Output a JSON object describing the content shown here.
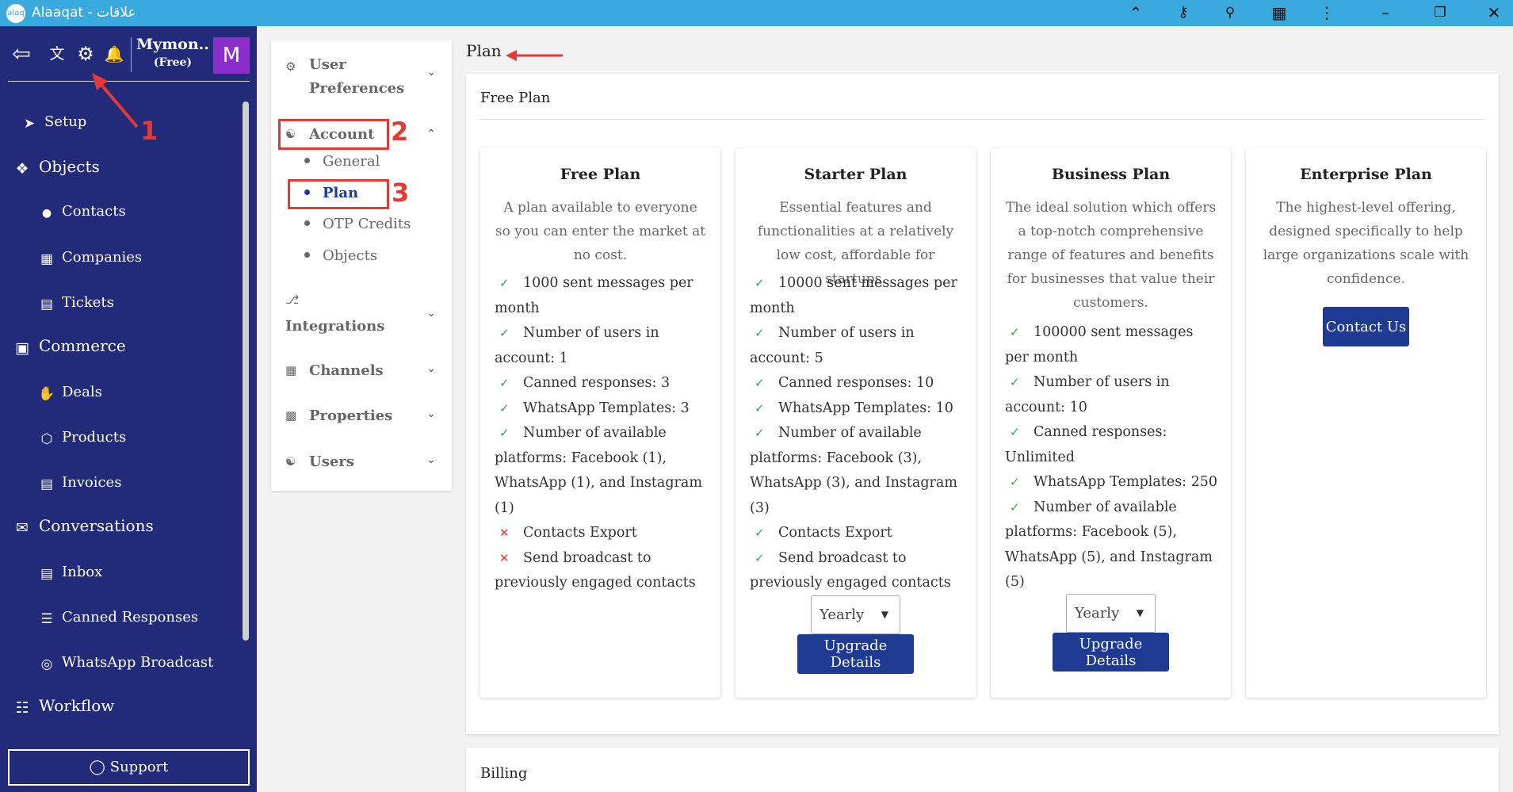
{
  "window": {
    "logo_text": "alaq",
    "title": "Alaaqat - علاقات",
    "icons": [
      "chevron-up-icon",
      "key-icon",
      "search-icon",
      "extension-icon",
      "more-vert-icon",
      "minimize-icon",
      "restore-icon",
      "close-icon"
    ]
  },
  "sidebar": {
    "user_name": "Mymon...",
    "user_plan": "(Free)",
    "avatar_letter": "M",
    "items": [
      {
        "label": "Setup",
        "icon": "rocket-icon",
        "type": "sub"
      },
      {
        "label": "Objects",
        "icon": "diamond-grid-icon",
        "type": "group"
      },
      {
        "label": "Contacts",
        "icon": "person-icon",
        "type": "sub"
      },
      {
        "label": "Companies",
        "icon": "building-icon",
        "type": "sub"
      },
      {
        "label": "Tickets",
        "icon": "ticket-icon",
        "type": "sub"
      },
      {
        "label": "Commerce",
        "icon": "bag-icon",
        "type": "group"
      },
      {
        "label": "Deals",
        "icon": "handshake-icon",
        "type": "sub"
      },
      {
        "label": "Products",
        "icon": "box-icon",
        "type": "sub"
      },
      {
        "label": "Invoices",
        "icon": "invoice-icon",
        "type": "sub"
      },
      {
        "label": "Conversations",
        "icon": "chat-icon",
        "type": "group"
      },
      {
        "label": "Inbox",
        "icon": "inbox-icon",
        "type": "sub"
      },
      {
        "label": "Canned Responses",
        "icon": "canned-icon",
        "type": "sub"
      },
      {
        "label": "WhatsApp Broadcast",
        "icon": "broadcast-icon",
        "type": "sub"
      },
      {
        "label": "Workflow",
        "icon": "sitemap-icon",
        "type": "group"
      }
    ],
    "support_label": "Support"
  },
  "settings_nav": {
    "user_preferences": "User Preferences",
    "account": "Account",
    "account_sub": [
      "General",
      "Plan",
      "OTP Credits",
      "Objects"
    ],
    "integrations": "Integrations",
    "channels": "Channels",
    "properties": "Properties",
    "users": "Users"
  },
  "annotations": {
    "n1": "1",
    "n2": "2",
    "n3": "3"
  },
  "main": {
    "page_title": "Plan",
    "section_title": "Free Plan",
    "billing_title": "Billing",
    "plans": [
      {
        "name": "Free Plan",
        "description": "A plan available to everyone so you can enter the market at no cost.",
        "features": [
          {
            "text": "1000 sent messages per month",
            "included": true
          },
          {
            "text": "Number of users in account: 1",
            "included": true
          },
          {
            "text": "Canned responses: 3",
            "included": true
          },
          {
            "text": "WhatsApp Templates: 3",
            "included": true
          },
          {
            "text": "Number of available platforms: Facebook (1), WhatsApp (1), and Instagram (1)",
            "included": true
          },
          {
            "text": "Contacts Export",
            "included": false
          },
          {
            "text": "Send broadcast to previously engaged contacts",
            "included": false
          }
        ]
      },
      {
        "name": "Starter Plan",
        "description": "Essential features and functionalities at a relatively low cost, affordable for startups.",
        "features": [
          {
            "text": "10000 sent messages per month",
            "included": true
          },
          {
            "text": "Number of users in account: 5",
            "included": true
          },
          {
            "text": "Canned responses: 10",
            "included": true
          },
          {
            "text": "WhatsApp Templates: 10",
            "included": true
          },
          {
            "text": "Number of available platforms: Facebook (3), WhatsApp (3), and Instagram (3)",
            "included": true
          },
          {
            "text": "Contacts Export",
            "included": true
          },
          {
            "text": "Send broadcast to previously engaged contacts",
            "included": true
          }
        ],
        "billing_period": "Yearly",
        "button": "Upgrade Details"
      },
      {
        "name": "Business Plan",
        "description": "The ideal solution which offers a top-notch comprehensive range of features and benefits for businesses that value their customers.",
        "features": [
          {
            "text": "100000 sent messages per month",
            "included": true
          },
          {
            "text": "Number of users in account: 10",
            "included": true
          },
          {
            "text": "Canned responses: Unlimited",
            "included": true
          },
          {
            "text": "WhatsApp Templates: 250",
            "included": true
          },
          {
            "text": "Number of available platforms: Facebook (5), WhatsApp (5), and Instagram (5)",
            "included": true
          }
        ],
        "billing_period": "Yearly",
        "button": "Upgrade Details"
      },
      {
        "name": "Enterprise Plan",
        "description": "The highest-level offering, designed specifically to help large organizations scale with confidence.",
        "button": "Contact Us"
      }
    ]
  },
  "colors": {
    "sidebar_bg": "#222a7a",
    "titlebar_bg": "#3aa9dd",
    "primary": "#1f3a93",
    "check": "#3f9b5a",
    "cross": "#e53935",
    "annotation": "#e53935"
  }
}
